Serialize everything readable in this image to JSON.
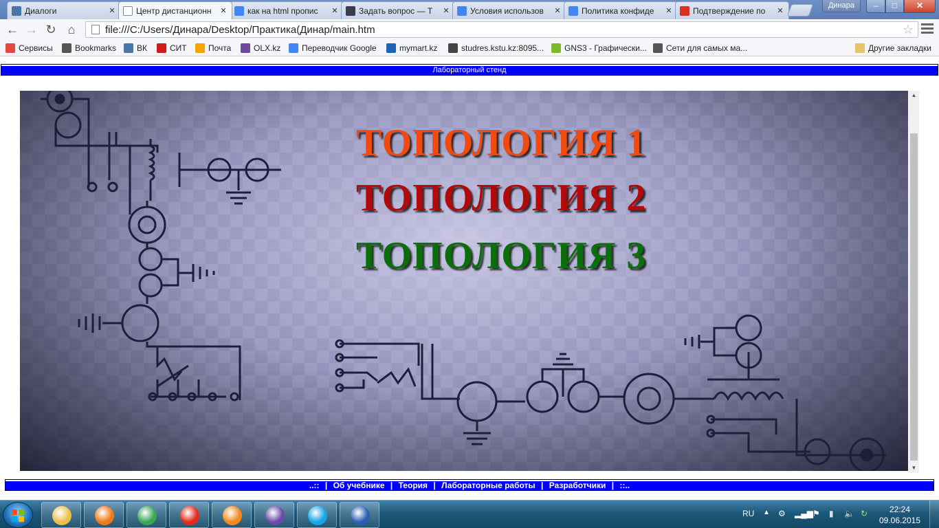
{
  "browser": {
    "tabs": [
      {
        "label": "Диалоги",
        "favicon": "vk-icon",
        "color": "#4a76a8",
        "active": false
      },
      {
        "label": "Центр дистанционн",
        "favicon": "page-icon",
        "color": "#ffffff",
        "active": true
      },
      {
        "label": "как на html пропис",
        "favicon": "google-icon",
        "color": "#4285f4",
        "active": false
      },
      {
        "label": "Задать вопрос — Т",
        "favicon": "toster-icon",
        "color": "#3b3b4f",
        "active": false
      },
      {
        "label": "Условия использов",
        "favicon": "google-icon",
        "color": "#4285f4",
        "active": false
      },
      {
        "label": "Политика конфиде",
        "favicon": "google-icon",
        "color": "#4285f4",
        "active": false
      },
      {
        "label": "Подтверждение по",
        "favicon": "gmail-icon",
        "color": "#d93025",
        "active": false
      }
    ],
    "user_badge": "Динара",
    "address": "file:///C:/Users/Динара/Desktop/Практика(Динар/main.htm",
    "bookmarks": [
      {
        "label": "Сервисы",
        "icon": "apps-grid-icon",
        "color": "#e04a3f"
      },
      {
        "label": "Bookmarks",
        "icon": "star-icon",
        "color": "#555555"
      },
      {
        "label": "ВК",
        "icon": "vk-icon",
        "color": "#4a76a8"
      },
      {
        "label": "СИТ",
        "icon": "k-icon",
        "color": "#d01c1c"
      },
      {
        "label": "Почта",
        "icon": "mail-ring-icon",
        "color": "#f5a400"
      },
      {
        "label": "OLX.kz",
        "icon": "olx-icon",
        "color": "#6c4a9c"
      },
      {
        "label": "Переводчик Google",
        "icon": "translate-icon",
        "color": "#4285f4"
      },
      {
        "label": "mymart.kz",
        "icon": "mymart-icon",
        "color": "#1e63b4"
      },
      {
        "label": "studres.kstu.kz:8095...",
        "icon": "dots-icon",
        "color": "#444444"
      },
      {
        "label": "GNS3 - Графически...",
        "icon": "gns3-icon",
        "color": "#7bb82c"
      },
      {
        "label": "Сети для самых ма...",
        "icon": "globe-icon",
        "color": "#555555"
      }
    ],
    "other_bookmarks": "Другие закладки"
  },
  "page": {
    "header_title": "Лабораторный стенд",
    "topologies": [
      {
        "label": "ТОПОЛОГИЯ 1",
        "color": "#f04a10"
      },
      {
        "label": "ТОПОЛОГИЯ 2",
        "color": "#b20a0a"
      },
      {
        "label": "ТОПОЛОГИЯ 3",
        "color": "#0a6e0a"
      }
    ],
    "footer_nav": {
      "left_mark": "..::",
      "links": [
        "Об учебнике",
        "Теория",
        "Лабораторные работы",
        "Разработчики"
      ],
      "right_mark": "::.."
    }
  },
  "taskbar": {
    "apps": [
      {
        "name": "explorer",
        "color": "#e8c04a"
      },
      {
        "name": "media-player",
        "color": "#f07a1a"
      },
      {
        "name": "chrome",
        "color": "#3aa757"
      },
      {
        "name": "yandex-browser",
        "color": "#e52a1c"
      },
      {
        "name": "firefox",
        "color": "#f08a1c"
      },
      {
        "name": "visual-studio",
        "color": "#6a4ca8"
      },
      {
        "name": "skype",
        "color": "#14a7e8"
      },
      {
        "name": "word",
        "color": "#2b5fb4"
      }
    ],
    "language": "RU",
    "time": "22:24",
    "date": "09.06.2015"
  }
}
